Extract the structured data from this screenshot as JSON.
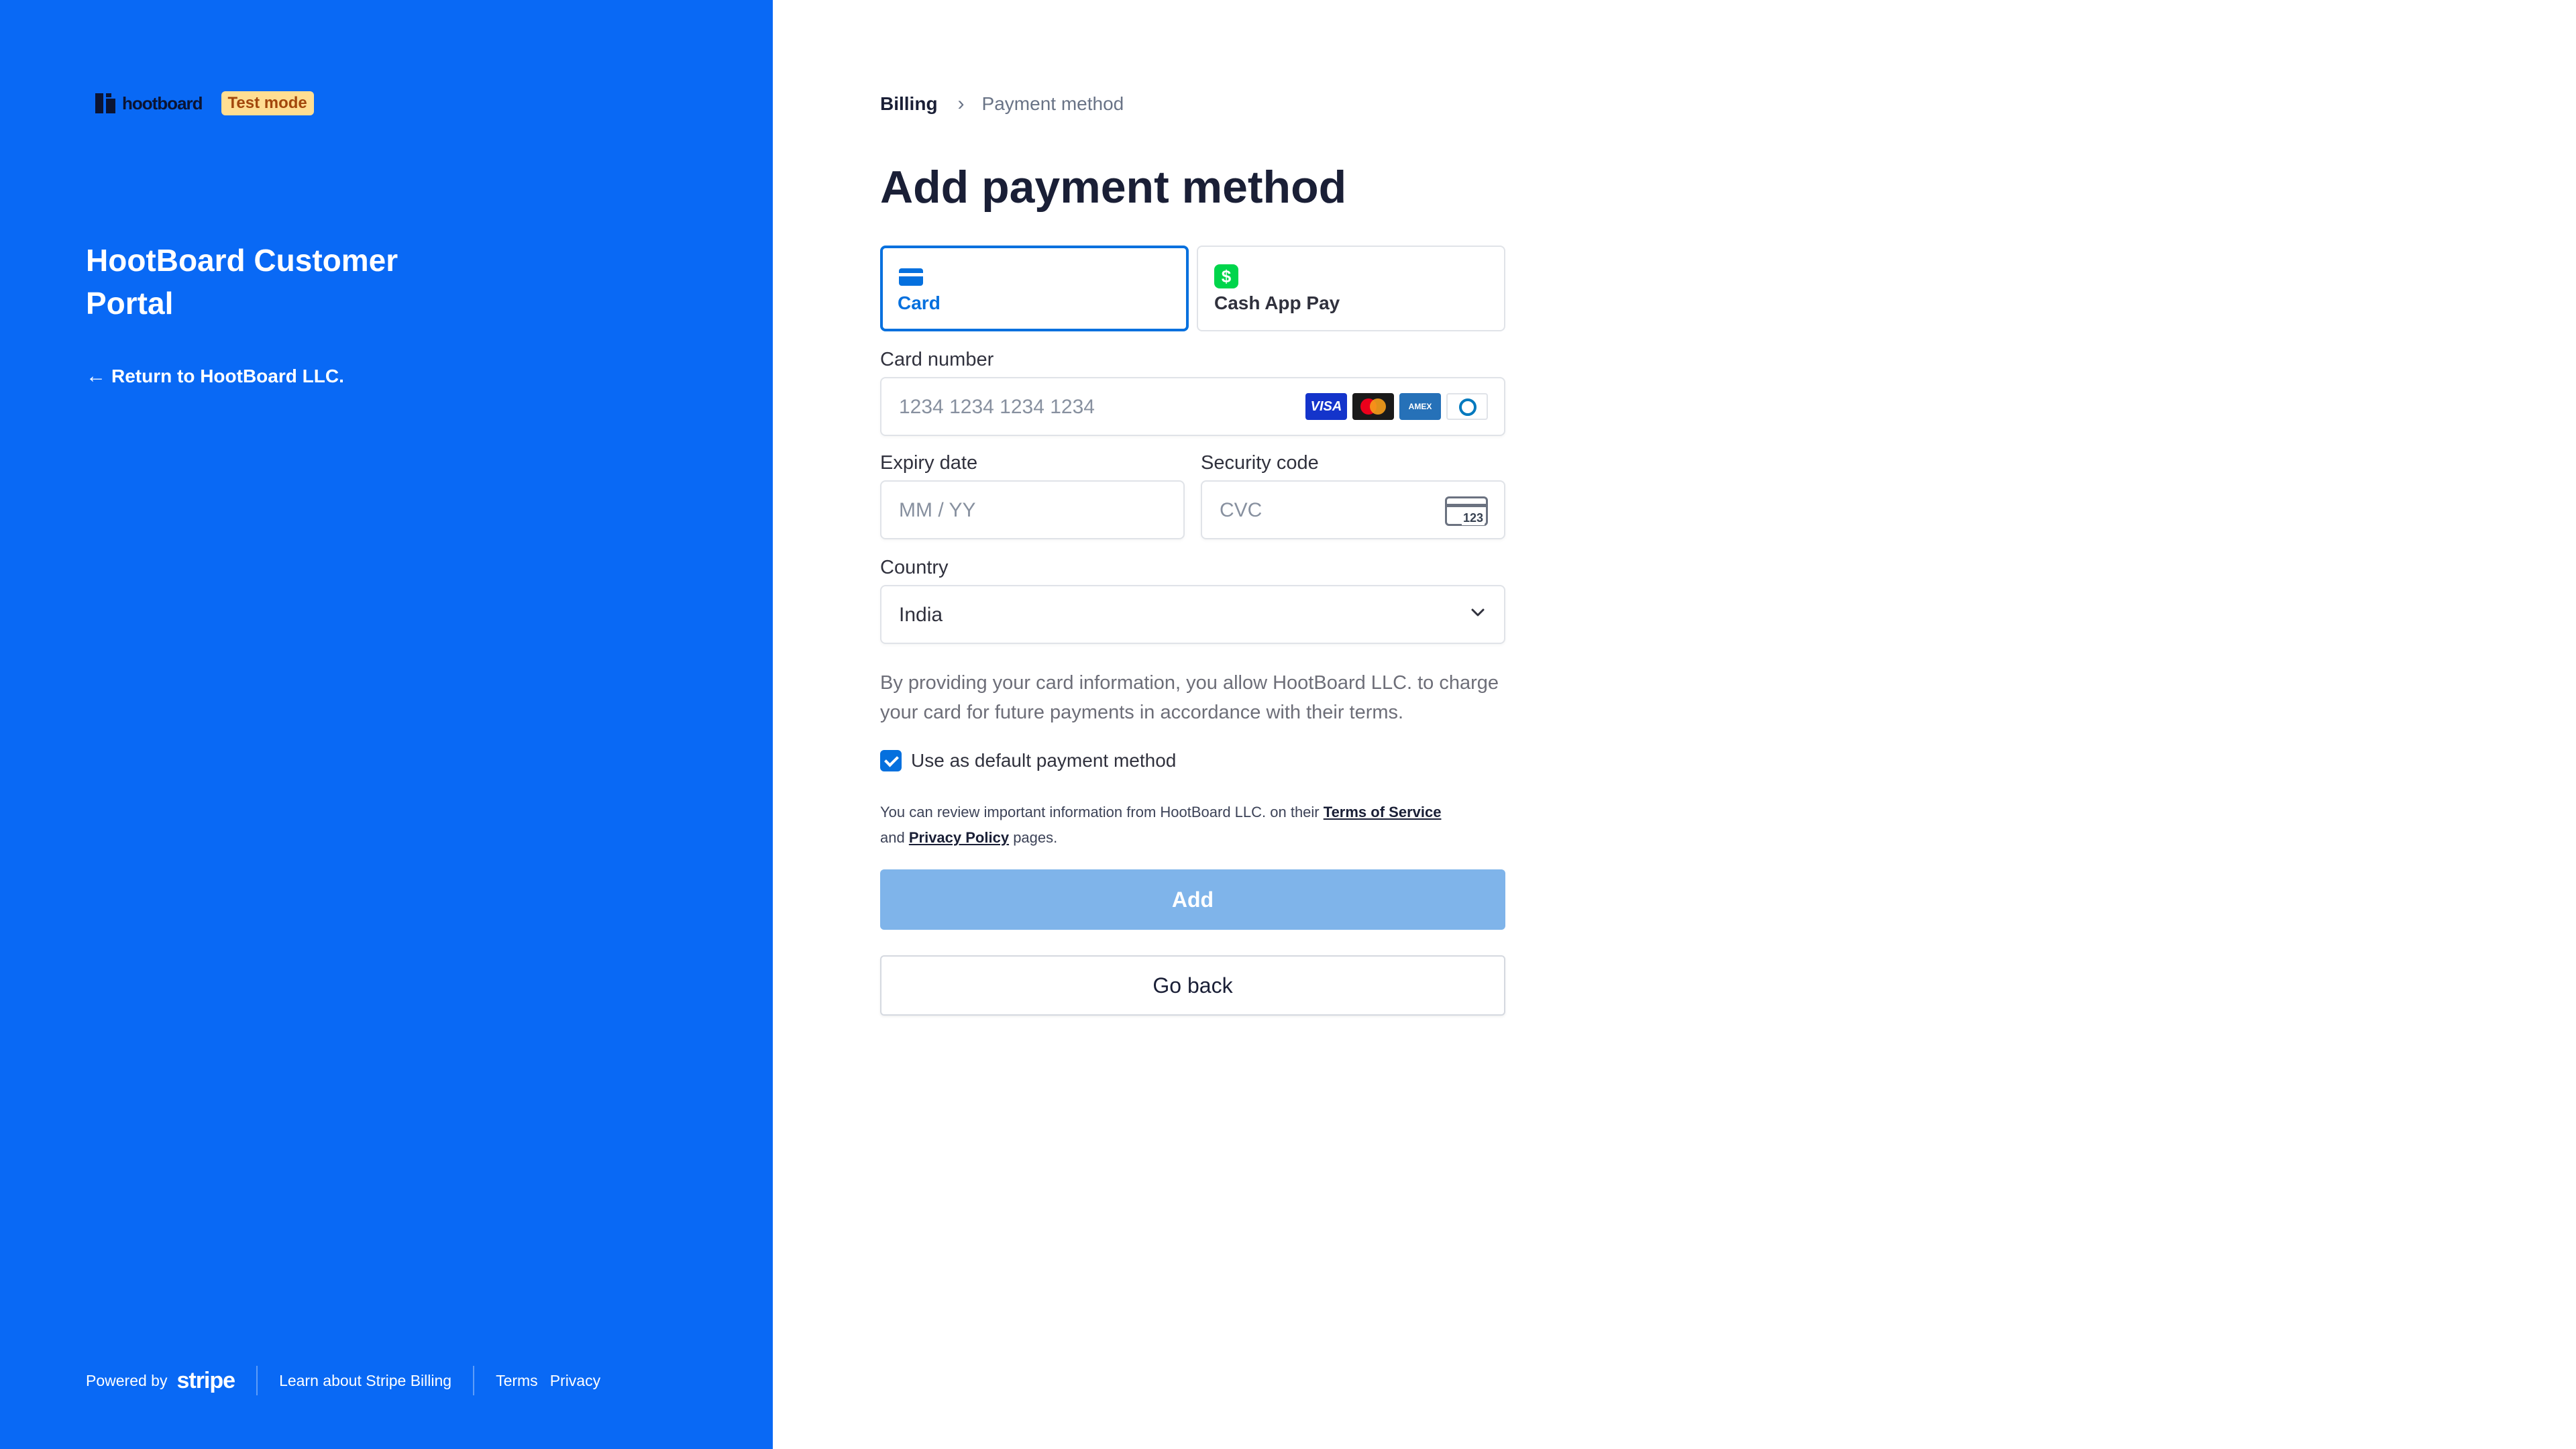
{
  "sidebar": {
    "logo_text": "hootboard",
    "badge": "Test mode",
    "portal_title": "HootBoard Customer Portal",
    "return_link": "Return to HootBoard LLC.",
    "footer": {
      "powered_by": "Powered by",
      "stripe": "stripe",
      "learn": "Learn about Stripe Billing",
      "terms": "Terms",
      "privacy": "Privacy"
    }
  },
  "breadcrumb": {
    "parent": "Billing",
    "current": "Payment method"
  },
  "page_title": "Add payment method",
  "payment_tabs": [
    {
      "label": "Card",
      "icon": "card-icon",
      "selected": true
    },
    {
      "label": "Cash App Pay",
      "icon": "cash-app-icon",
      "selected": false
    }
  ],
  "form": {
    "card_number": {
      "label": "Card number",
      "placeholder": "1234 1234 1234 1234"
    },
    "card_brands": [
      "VISA",
      "Mastercard",
      "AMEX",
      "Diners"
    ],
    "expiry": {
      "label": "Expiry date",
      "placeholder": "MM / YY"
    },
    "security": {
      "label": "Security code",
      "placeholder": "CVC",
      "icon_text": "123"
    },
    "country": {
      "label": "Country",
      "value": "India"
    }
  },
  "consent_text": "By providing your card information, you allow HootBoard LLC. to charge your card for future payments in accordance with their terms.",
  "default_checkbox": {
    "label": "Use as default payment method",
    "checked": true
  },
  "legal": {
    "prefix": "You can review important information from HootBoard LLC. on their",
    "terms_link": "Terms of Service",
    "middle": "and",
    "privacy_link": "Privacy Policy",
    "suffix": "pages."
  },
  "buttons": {
    "add": "Add",
    "back": "Go back"
  },
  "colors": {
    "sidebar_bg": "#0969f5",
    "accent": "#0570de",
    "add_button_disabled": "#7fb4ea"
  }
}
